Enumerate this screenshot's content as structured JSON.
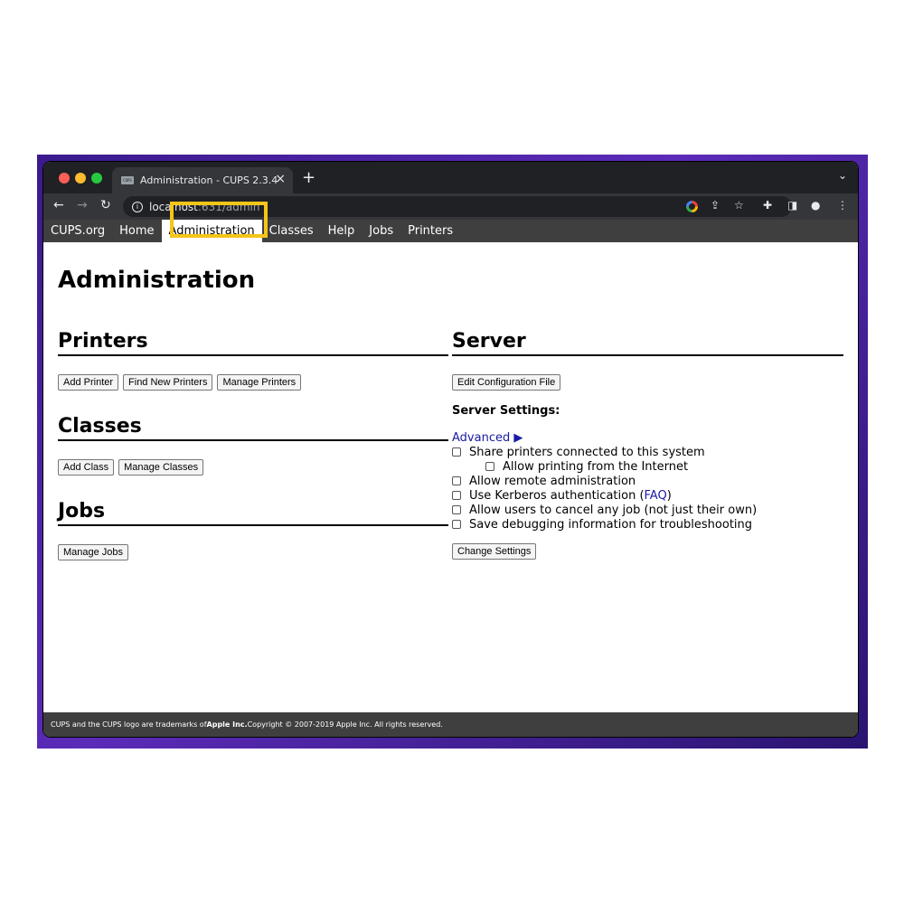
{
  "browser": {
    "tab_title": "Administration - CUPS 2.3.4",
    "tab_favicon_text": "CUPS",
    "new_tab_symbol": "+",
    "url_host": "localhost",
    "url_path": ":631/admin"
  },
  "nav": {
    "items": [
      "CUPS.org",
      "Home",
      "Administration",
      "Classes",
      "Help",
      "Jobs",
      "Printers"
    ],
    "active": "Administration"
  },
  "page": {
    "title": "Administration"
  },
  "printers": {
    "heading": "Printers",
    "buttons": [
      "Add Printer",
      "Find New Printers",
      "Manage Printers"
    ]
  },
  "classes": {
    "heading": "Classes",
    "buttons": [
      "Add Class",
      "Manage Classes"
    ]
  },
  "jobs": {
    "heading": "Jobs",
    "buttons": [
      "Manage Jobs"
    ]
  },
  "server": {
    "heading": "Server",
    "edit_config_label": "Edit Configuration File",
    "settings_title": "Server Settings:",
    "advanced_label": "Advanced ▶",
    "options": {
      "share": "Share printers connected to this system",
      "internet": "Allow printing from the Internet",
      "remote_admin": "Allow remote administration",
      "kerberos": "Use Kerberos authentication (",
      "kerberos_link": "FAQ",
      "kerberos_close": ")",
      "cancel_jobs": "Allow users to cancel any job (not just their own)",
      "debug": "Save debugging information for troubleshooting"
    },
    "change_settings_label": "Change Settings"
  },
  "footer": {
    "text_before": "CUPS and the CUPS logo are trademarks of ",
    "company": "Apple Inc.",
    "text_after": " Copyright © 2007-2019 Apple Inc. All rights reserved."
  },
  "colors": {
    "highlight": "#f5c518",
    "link": "#1a1aa6",
    "nav_bg": "#3f3f3f"
  }
}
